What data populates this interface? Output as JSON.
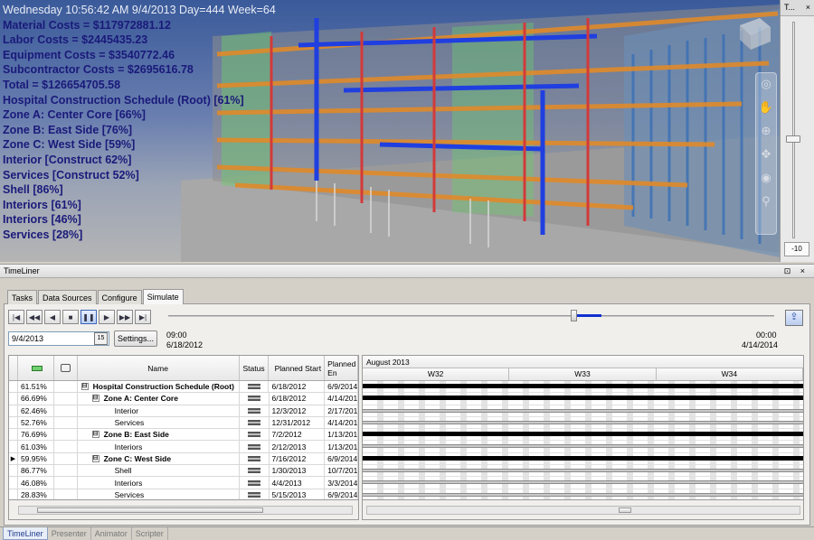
{
  "viewport": {
    "overlay_header": "Wednesday 10:56:42 AM 9/4/2013 Day=444 Week=64",
    "overlay_lines": [
      "Material Costs = $117972881.12",
      "Labor Costs = $2445435.23",
      "Equipment Costs = $3540772.46",
      "Subcontractor Costs = $2695616.78",
      "Total = $126654705.58",
      "Hospital Construction Schedule (Root) [61%]",
      "Zone A: Center Core [66%]",
      "Zone B: East Side [76%]",
      "Zone C: West Side [59%]",
      "Interior [Construct 62%]",
      "Services [Construct 52%]",
      "Shell [86%]",
      "Interiors [61%]",
      "Interiors [46%]",
      "Services [28%]"
    ]
  },
  "nav_panel": {
    "title": "T...",
    "close": "×",
    "zoom_value": "-10",
    "tool_icons": [
      "steering-wheel-icon",
      "pan-hand-icon",
      "zoom-window-icon",
      "orbit-icon",
      "look-icon",
      "walk-icon"
    ]
  },
  "timeliner": {
    "title": "TimeLiner",
    "title_controls": "⊡ ×",
    "tabs": [
      "Tasks",
      "Data Sources",
      "Configure",
      "Simulate"
    ],
    "active_tab": "Simulate",
    "playback_buttons": [
      "|◀",
      "◀◀",
      "◀",
      "■",
      "❚❚",
      "▶",
      "▶▶",
      "▶|"
    ],
    "active_playback": 4,
    "current_date": "9/4/2013",
    "calendar_label": "15",
    "settings_label": "Settings...",
    "start_time": "09:00",
    "start_date": "6/18/2012",
    "end_time": "00:00",
    "end_date": "4/14/2014",
    "export_icon": "export-movie-icon",
    "progress_position": 0.67
  },
  "grid": {
    "columns": [
      "",
      "Name",
      "Status",
      "Planned Start",
      "Planned En"
    ],
    "rows": [
      {
        "marker": "",
        "pct": "61.51%",
        "name": "Hospital Construction Schedule (Root)",
        "indent": 0,
        "toggle": "⊟",
        "bold": true,
        "start": "6/18/2012",
        "end": "6/9/2014"
      },
      {
        "marker": "",
        "pct": "66.69%",
        "name": "Zone A: Center Core",
        "indent": 1,
        "toggle": "⊟",
        "bold": true,
        "start": "6/18/2012",
        "end": "4/14/2014"
      },
      {
        "marker": "",
        "pct": "62.46%",
        "name": "Interior",
        "indent": 2,
        "toggle": "",
        "bold": false,
        "start": "12/3/2012",
        "end": "2/17/2014"
      },
      {
        "marker": "",
        "pct": "52.76%",
        "name": "Services",
        "indent": 2,
        "toggle": "",
        "bold": false,
        "start": "12/31/2012",
        "end": "4/14/2014"
      },
      {
        "marker": "",
        "pct": "76.69%",
        "name": "Zone B: East Side",
        "indent": 1,
        "toggle": "⊟",
        "bold": true,
        "start": "7/2/2012",
        "end": "1/13/2014"
      },
      {
        "marker": "",
        "pct": "61.03%",
        "name": "Interiors",
        "indent": 2,
        "toggle": "",
        "bold": false,
        "start": "2/12/2013",
        "end": "1/13/2014"
      },
      {
        "marker": "▶",
        "pct": "59.95%",
        "name": "Zone C: West Side",
        "indent": 1,
        "toggle": "⊟",
        "bold": true,
        "start": "7/16/2012",
        "end": "6/9/2014"
      },
      {
        "marker": "",
        "pct": "86.77%",
        "name": "Shell",
        "indent": 2,
        "toggle": "",
        "bold": false,
        "start": "1/30/2013",
        "end": "10/7/2013"
      },
      {
        "marker": "",
        "pct": "46.08%",
        "name": "Interiors",
        "indent": 2,
        "toggle": "",
        "bold": false,
        "start": "4/4/2013",
        "end": "3/3/2014"
      },
      {
        "marker": "",
        "pct": "28.83%",
        "name": "Services",
        "indent": 2,
        "toggle": "",
        "bold": false,
        "start": "5/15/2013",
        "end": "6/9/2014"
      }
    ]
  },
  "gantt": {
    "month": "August 2013",
    "weeks": [
      "W32",
      "W33",
      "W34"
    ]
  },
  "bottom_tabs": [
    "TimeLiner",
    "Presenter",
    "Animator",
    "Scripter"
  ],
  "active_bottom_tab": "TimeLiner"
}
